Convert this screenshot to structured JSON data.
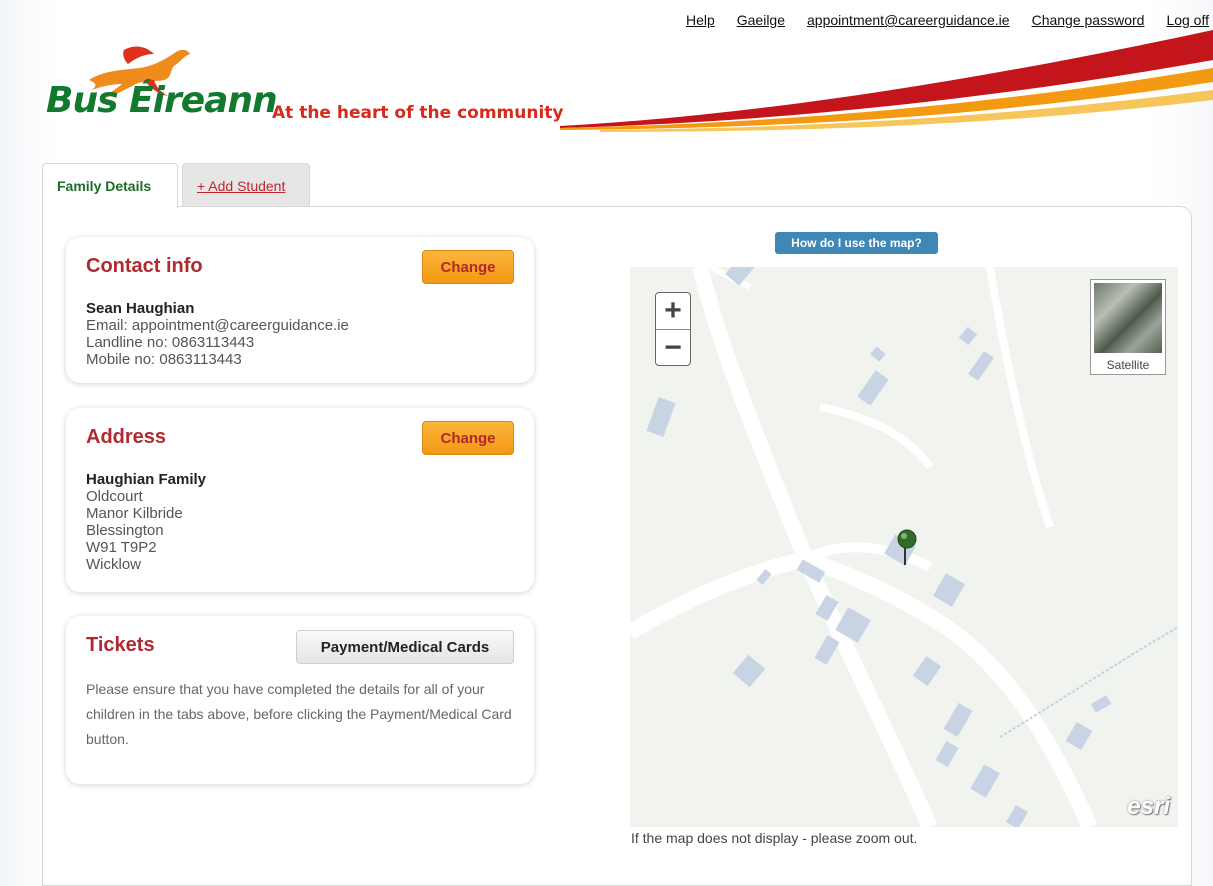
{
  "nav": {
    "help": "Help",
    "language": "Gaeilge",
    "email": "appointment@careerguidance.ie",
    "change_password": "Change password",
    "logoff": "Log off"
  },
  "brand": {
    "name": "Bus Éireann",
    "tagline": "At the heart of the community",
    "green": "#127a2e",
    "red": "#d62a1e"
  },
  "tabs": [
    {
      "label": "Family Details",
      "active": true
    },
    {
      "label": "+ Add Student",
      "active": false
    }
  ],
  "contact": {
    "title": "Contact info",
    "button": "Change",
    "name": "Sean Haughian",
    "email": "Email: appointment@careerguidance.ie",
    "landline": "Landline no: 0863113443",
    "mobile": "Mobile no: 0863113443"
  },
  "address": {
    "title": "Address",
    "button": "Change",
    "family": "Haughian Family",
    "lines": [
      "Oldcourt",
      "Manor Kilbride",
      "Blessington",
      "W91 T9P2",
      "Wicklow"
    ]
  },
  "tickets": {
    "title": "Tickets",
    "button": "Payment/Medical Cards",
    "text": "Please ensure that you have completed the details for all of your children in the tabs above, before clicking the Payment/Medical Card button."
  },
  "map": {
    "help_button": "How do I use the map?",
    "zoom_in": "+",
    "zoom_out": "−",
    "satellite_label": "Satellite",
    "attribution": "esri",
    "note": "If the map does not display - please zoom out."
  }
}
